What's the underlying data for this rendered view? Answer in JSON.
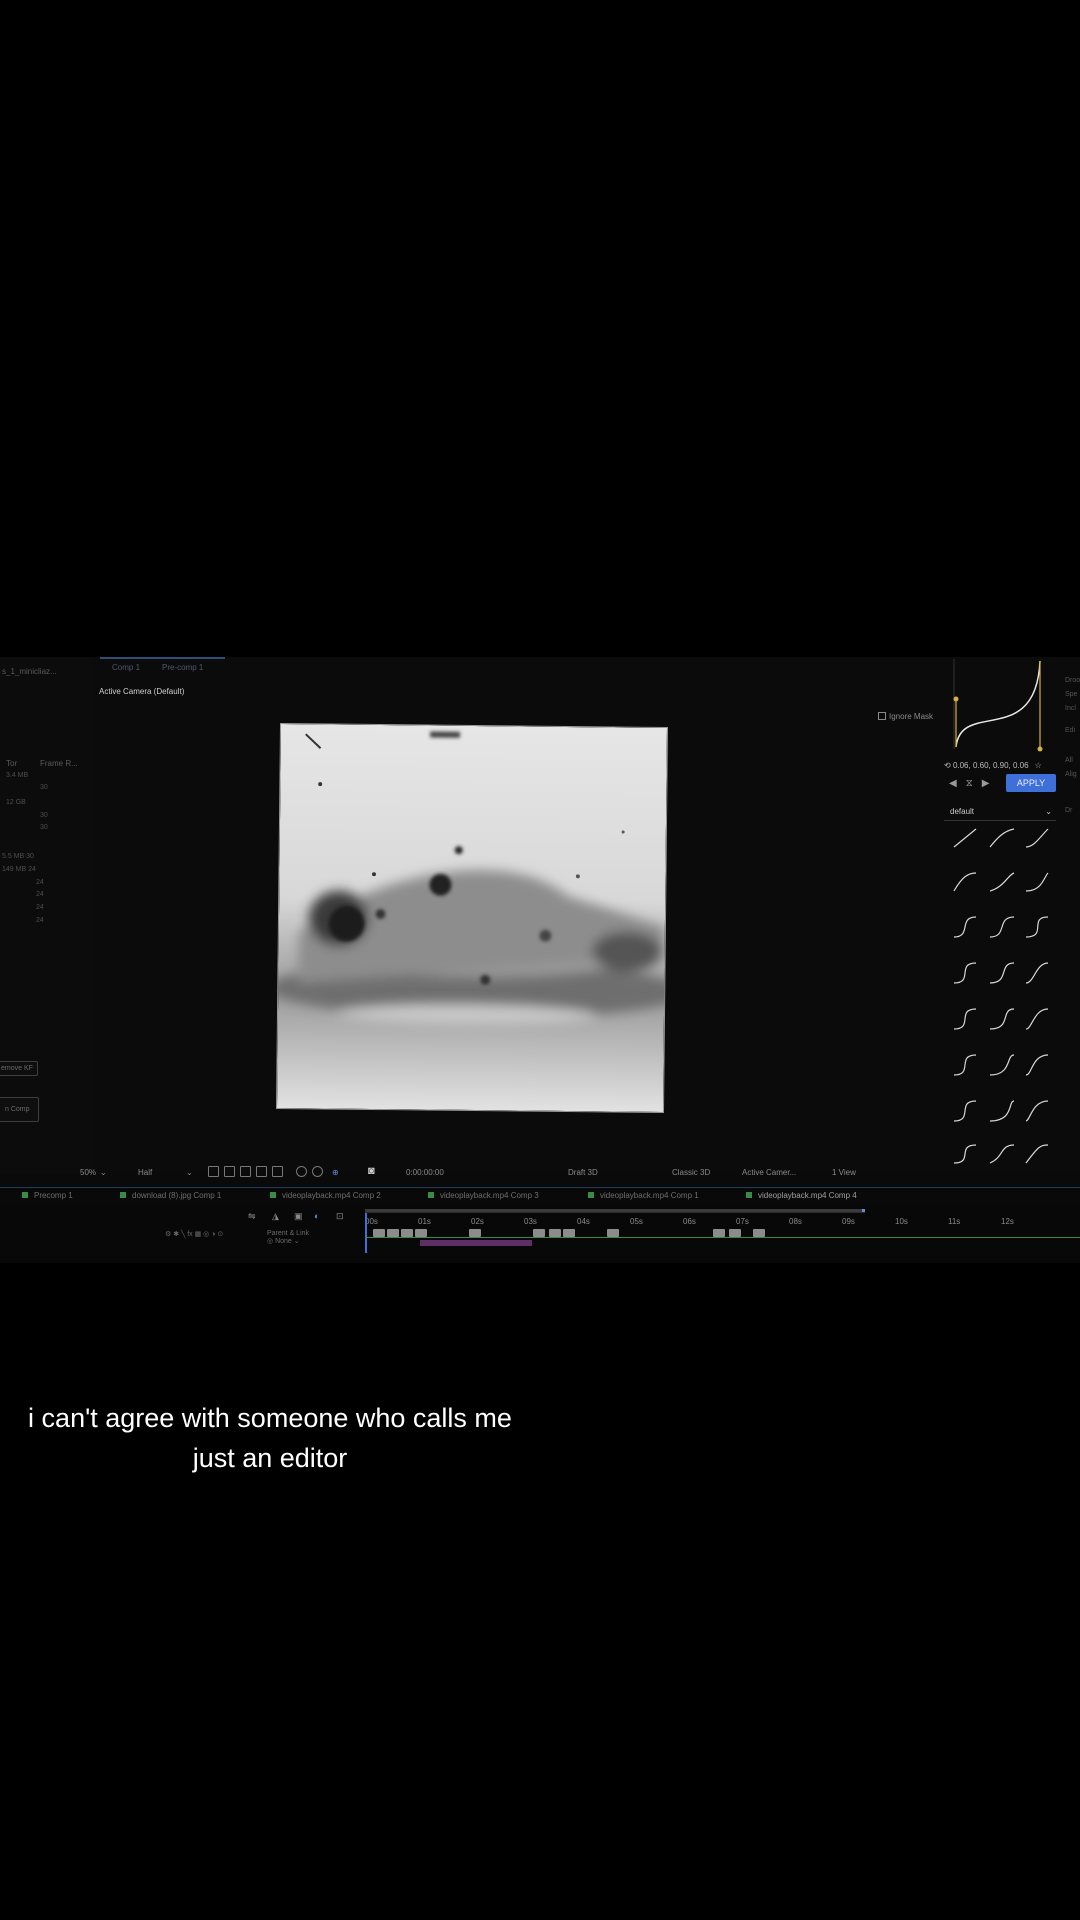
{
  "project": {
    "name": "s_1_minicliaz...",
    "col_type": "Tor",
    "col_frame": "Frame R...",
    "rows": [
      "3.4 MB",
      "30",
      "12 GB",
      "30",
      "30",
      "5.5 MB  30",
      "149 MB  24",
      "24",
      "24",
      "24",
      "24"
    ],
    "buttons": [
      "emove KF",
      "n Comp"
    ]
  },
  "viewer": {
    "tabs": [
      "Comp 1",
      "Pre-comp 1"
    ],
    "camera_label": "Active Camera (Default)",
    "ignore_mask": "Ignore Mask",
    "zoom": "50%",
    "resolution": "Half",
    "timecode": "0:00:00:00",
    "renderer": "Draft 3D",
    "renderer_mode": "Classic 3D",
    "camera_select": "Active Camer...",
    "view_layout": "1 View"
  },
  "easing": {
    "coords": "0.06, 0.60, 0.90, 0.06",
    "apply": "APPLY",
    "preset": "default"
  },
  "comp_tabs": [
    "Precomp 1",
    "download (8).jpg Comp 1",
    "videoplayback.mp4 Comp 2",
    "videoplayback.mp4 Comp 3",
    "videoplayback.mp4 Comp 1",
    "videoplayback.mp4 Comp 4"
  ],
  "timeline": {
    "ticks": [
      "00s",
      "01s",
      "02s",
      "03s",
      "04s",
      "05s",
      "06s",
      "07s",
      "08s",
      "09s",
      "10s",
      "11s",
      "12s"
    ],
    "parent_header": "Parent & Link",
    "parent_value": "None"
  },
  "caption": {
    "line1": "i can't agree with someone who calls me",
    "line2": "just an editor"
  }
}
